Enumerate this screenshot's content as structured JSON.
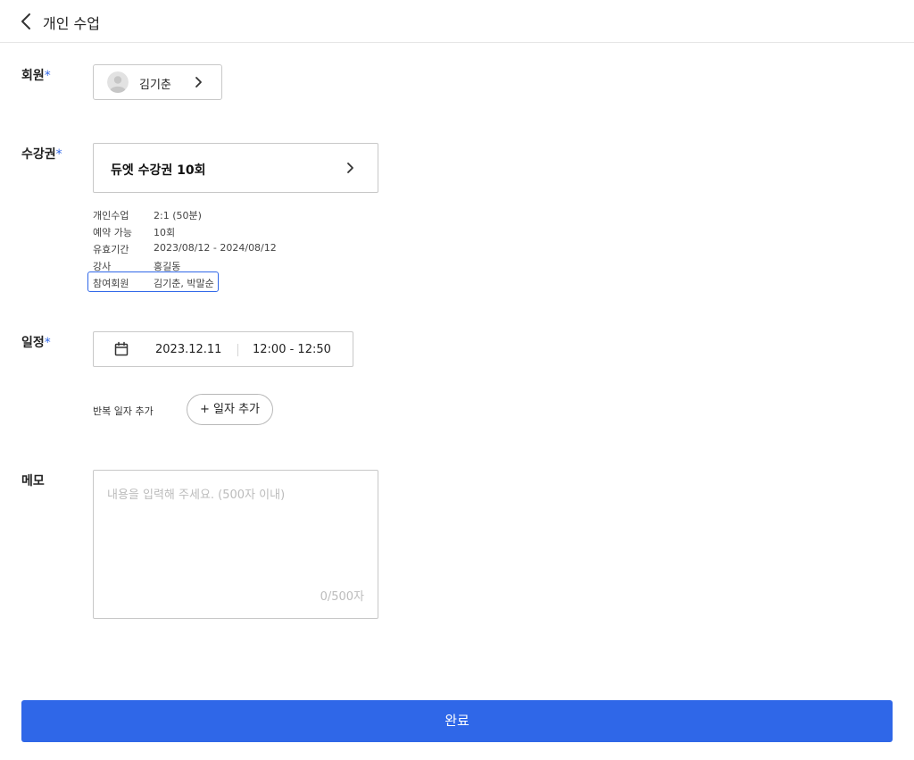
{
  "header": {
    "title": "개인 수업",
    "back_icon": "chevron-left-icon"
  },
  "member": {
    "label": "회원",
    "required_mark": "*",
    "name": "김기춘"
  },
  "ticket": {
    "label": "수강권",
    "required_mark": "*",
    "name": "듀엣 수강권 10회",
    "info": [
      {
        "key": "개인수업",
        "value": "2:1 (50분)"
      },
      {
        "key": "예약 가능",
        "value": "10회"
      },
      {
        "key": "유효기간",
        "value": "2023/08/12 - 2024/08/12"
      },
      {
        "key": "강사",
        "value": "홍길동"
      },
      {
        "key": "참여회원",
        "value": "김기춘, 박말순"
      }
    ]
  },
  "schedule": {
    "label": "일정",
    "required_mark": "*",
    "date": "2023.12.11",
    "time": "12:00 - 12:50",
    "repeat_label": "반복 일자 추가",
    "add_date_button": "+ 일자 추가"
  },
  "memo": {
    "label": "메모",
    "value": "",
    "placeholder": "내용을 입력해 주세요. (500자 이내)",
    "counter": "0/500자"
  },
  "footer": {
    "submit_label": "완료"
  },
  "colors": {
    "accent": "#2f67e8",
    "border": "#c8c8c8",
    "placeholder": "#bcbcbc"
  }
}
